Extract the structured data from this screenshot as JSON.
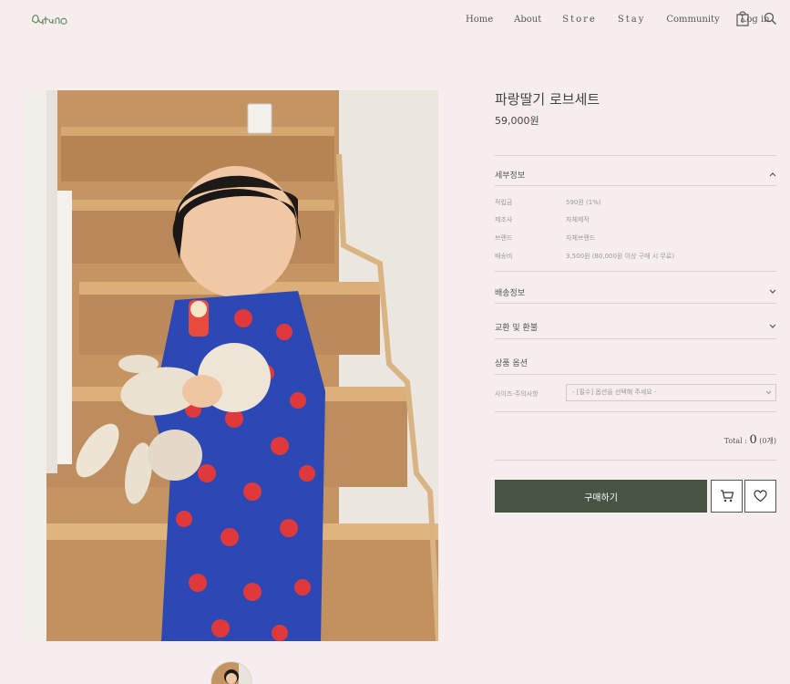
{
  "header": {
    "nav": [
      "Home",
      "About",
      "Store",
      "Stay",
      "Community",
      "Log in"
    ],
    "cart_count": "0"
  },
  "product": {
    "name": "파랑딸기 로브세트",
    "price": "59,000원"
  },
  "sections": {
    "detail_title": "세부정보",
    "shipping_title": "배송정보",
    "exchange_title": "교환 및 환불",
    "options_title": "상품 옵션"
  },
  "detail_rows": [
    {
      "key": "적립금",
      "value": "590원 (1%)"
    },
    {
      "key": "제조사",
      "value": "자체제작"
    },
    {
      "key": "브랜드",
      "value": "자체브랜드"
    },
    {
      "key": "배송비",
      "value": "3,500원 (80,000원 이상 구매 시 무료)"
    }
  ],
  "option": {
    "label": "사이즈-주의사항",
    "placeholder": "- [필수] 옵션을 선택해 주세요 -"
  },
  "total": {
    "label": "Total : ",
    "amount": "0",
    "count": "(0개)"
  },
  "buttons": {
    "buy": "구매하기"
  },
  "colors": {
    "background": "#f6eeec",
    "buy_button": "#4a5444",
    "accent_logo": "#6b8a6b"
  },
  "icons": [
    "logo-icon",
    "cart-icon",
    "search-icon",
    "chevron-up-icon",
    "chevron-down-icon",
    "cart-icon",
    "heart-icon"
  ]
}
